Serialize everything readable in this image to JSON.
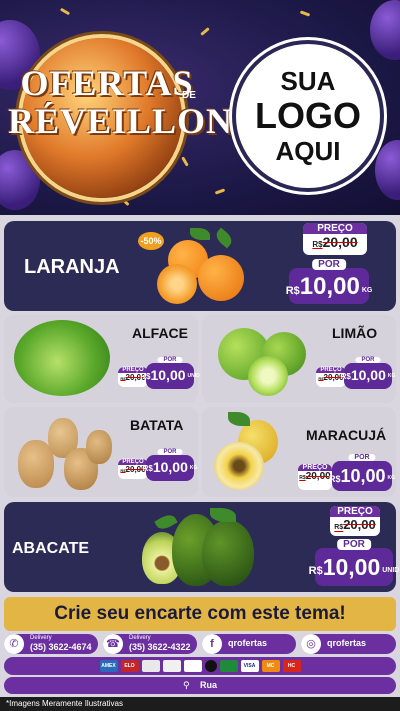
{
  "header": {
    "title_line1": "OFERTAS",
    "title_de": "DE",
    "title_line2": "RÉVEILLON",
    "logo_line1": "SUA",
    "logo_line2": "LOGO",
    "logo_line3": "AQUI"
  },
  "products": {
    "laranja": {
      "name": "LARANJA",
      "discount": "-50%",
      "preco_label": "PREÇO",
      "old_currency": "R$",
      "old_price": "20,00",
      "por_label": "POR",
      "currency": "R$",
      "price": "10,00",
      "unit": "KG"
    },
    "alface": {
      "name": "ALFACE",
      "preco_label": "PREÇO",
      "old_currency": "R$",
      "old_price": "20,00",
      "por_label": "POR",
      "currency": "R$",
      "price": "10,00",
      "unit": "UNID"
    },
    "limao": {
      "name": "LIMÃO",
      "preco_label": "PREÇO",
      "old_currency": "R$",
      "old_price": "20,00",
      "por_label": "POR",
      "currency": "R$",
      "price": "10,00",
      "unit": "KG"
    },
    "batata": {
      "name": "BATATA",
      "preco_label": "PREÇO",
      "old_currency": "R$",
      "old_price": "20,00",
      "por_label": "POR",
      "currency": "R$",
      "price": "10,00",
      "unit": "KG"
    },
    "maracuja": {
      "name": "MARACUJÁ",
      "preco_label": "PREÇO",
      "old_currency": "R$",
      "old_price": "20,00",
      "por_label": "POR",
      "currency": "R$",
      "price": "10,00",
      "unit": "KG"
    },
    "abacate": {
      "name": "ABACATE",
      "preco_label": "PREÇO",
      "old_currency": "R$",
      "old_price": "20,00",
      "por_label": "POR",
      "currency": "R$",
      "price": "10,00",
      "unit": "UNID"
    }
  },
  "banner": "Crie seu encarte com este tema!",
  "contacts": {
    "whatsapp_label": "Delivery",
    "whatsapp_number": "(35) 3622-4674",
    "phone_label": "Delivery",
    "phone_number": "(35) 3622-4322",
    "facebook": "qrofertas",
    "instagram": "qrofertas"
  },
  "payments": [
    "AMEX",
    "ELO",
    "",
    "",
    "",
    "",
    "",
    "VISA",
    "MC",
    "HC"
  ],
  "address": "Rua",
  "footer": "*Imagens Meramente Ilustrativas",
  "colors": {
    "purple": "#6c2fa0",
    "dark_card": "#2c2b56",
    "gold": "#e3b545"
  }
}
